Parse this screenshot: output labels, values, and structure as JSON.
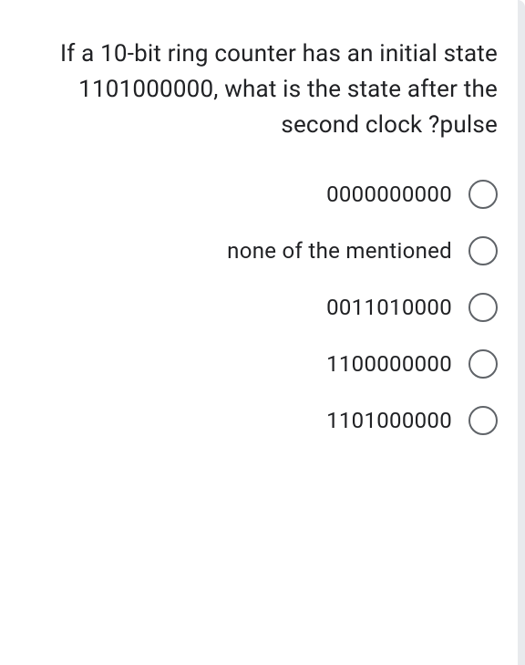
{
  "question": {
    "text": "If a 10-bit ring counter has an initial state 1101000000, what is the state after the second clock ?pulse"
  },
  "options": [
    {
      "label": "0000000000"
    },
    {
      "label": "none of the mentioned"
    },
    {
      "label": "0011010000"
    },
    {
      "label": "1100000000"
    },
    {
      "label": "1101000000"
    }
  ]
}
